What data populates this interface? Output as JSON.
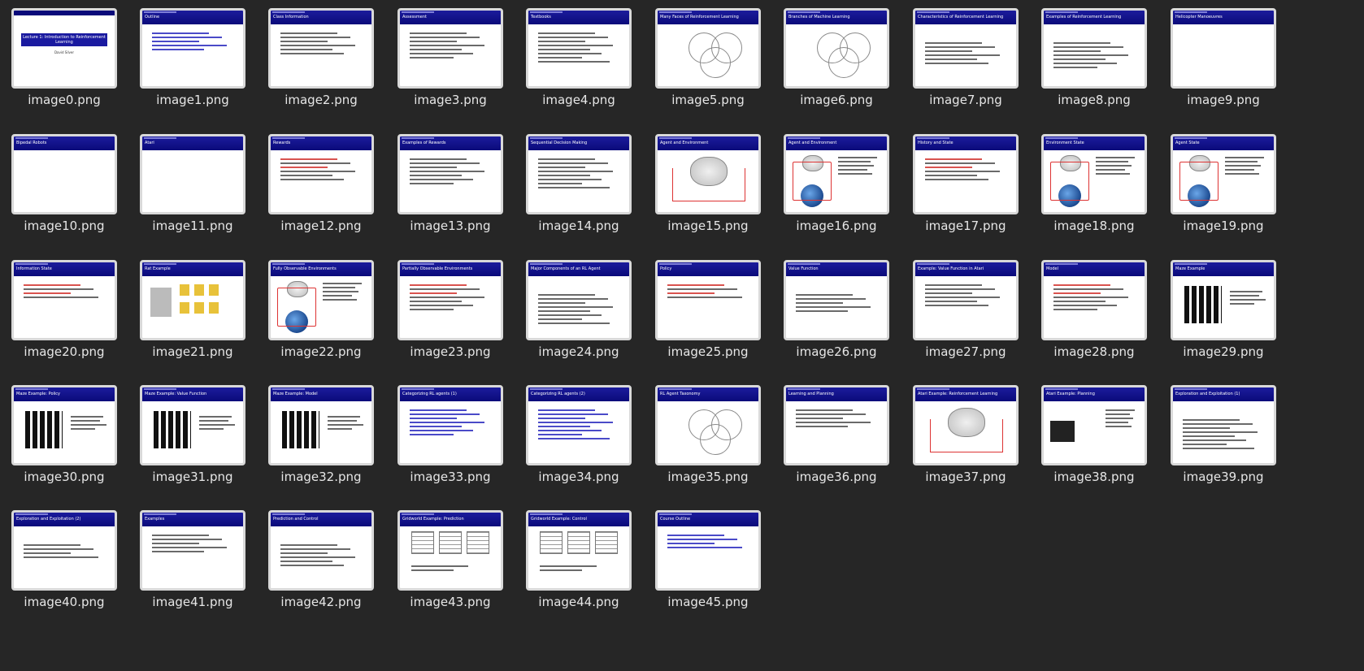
{
  "files": [
    {
      "name": "image0.png",
      "title": ""
    },
    {
      "name": "image1.png",
      "title": "Outline"
    },
    {
      "name": "image2.png",
      "title": "Class Information"
    },
    {
      "name": "image3.png",
      "title": "Assessment"
    },
    {
      "name": "image4.png",
      "title": "Textbooks"
    },
    {
      "name": "image5.png",
      "title": "Many Faces of Reinforcement Learning"
    },
    {
      "name": "image6.png",
      "title": "Branches of Machine Learning"
    },
    {
      "name": "image7.png",
      "title": "Characteristics of Reinforcement Learning"
    },
    {
      "name": "image8.png",
      "title": "Examples of Reinforcement Learning"
    },
    {
      "name": "image9.png",
      "title": "Helicopter Manoeuvres"
    },
    {
      "name": "image10.png",
      "title": "Bipedal Robots"
    },
    {
      "name": "image11.png",
      "title": "Atari"
    },
    {
      "name": "image12.png",
      "title": "Rewards"
    },
    {
      "name": "image13.png",
      "title": "Examples of Rewards"
    },
    {
      "name": "image14.png",
      "title": "Sequential Decision Making"
    },
    {
      "name": "image15.png",
      "title": "Agent and Environment"
    },
    {
      "name": "image16.png",
      "title": "Agent and Environment"
    },
    {
      "name": "image17.png",
      "title": "History and State"
    },
    {
      "name": "image18.png",
      "title": "Environment State"
    },
    {
      "name": "image19.png",
      "title": "Agent State"
    },
    {
      "name": "image20.png",
      "title": "Information State"
    },
    {
      "name": "image21.png",
      "title": "Rat Example"
    },
    {
      "name": "image22.png",
      "title": "Fully Observable Environments"
    },
    {
      "name": "image23.png",
      "title": "Partially Observable Environments"
    },
    {
      "name": "image24.png",
      "title": "Major Components of an RL Agent"
    },
    {
      "name": "image25.png",
      "title": "Policy"
    },
    {
      "name": "image26.png",
      "title": "Value Function"
    },
    {
      "name": "image27.png",
      "title": "Example: Value Function in Atari"
    },
    {
      "name": "image28.png",
      "title": "Model"
    },
    {
      "name": "image29.png",
      "title": "Maze Example"
    },
    {
      "name": "image30.png",
      "title": "Maze Example: Policy"
    },
    {
      "name": "image31.png",
      "title": "Maze Example: Value Function"
    },
    {
      "name": "image32.png",
      "title": "Maze Example: Model"
    },
    {
      "name": "image33.png",
      "title": "Categorizing RL agents (1)"
    },
    {
      "name": "image34.png",
      "title": "Categorizing RL agents (2)"
    },
    {
      "name": "image35.png",
      "title": "RL Agent Taxonomy"
    },
    {
      "name": "image36.png",
      "title": "Learning and Planning"
    },
    {
      "name": "image37.png",
      "title": "Atari Example: Reinforcement Learning"
    },
    {
      "name": "image38.png",
      "title": "Atari Example: Planning"
    },
    {
      "name": "image39.png",
      "title": "Exploration and Exploitation (1)"
    },
    {
      "name": "image40.png",
      "title": "Exploration and Exploitation (2)"
    },
    {
      "name": "image41.png",
      "title": "Examples"
    },
    {
      "name": "image42.png",
      "title": "Prediction and Control"
    },
    {
      "name": "image43.png",
      "title": "Gridworld Example: Prediction"
    },
    {
      "name": "image44.png",
      "title": "Gridworld Example: Control"
    },
    {
      "name": "image45.png",
      "title": "Course Outline"
    }
  ],
  "title_slide": {
    "heading": "Lecture 1: Introduction to Reinforcement Learning",
    "author": "David Silver"
  }
}
